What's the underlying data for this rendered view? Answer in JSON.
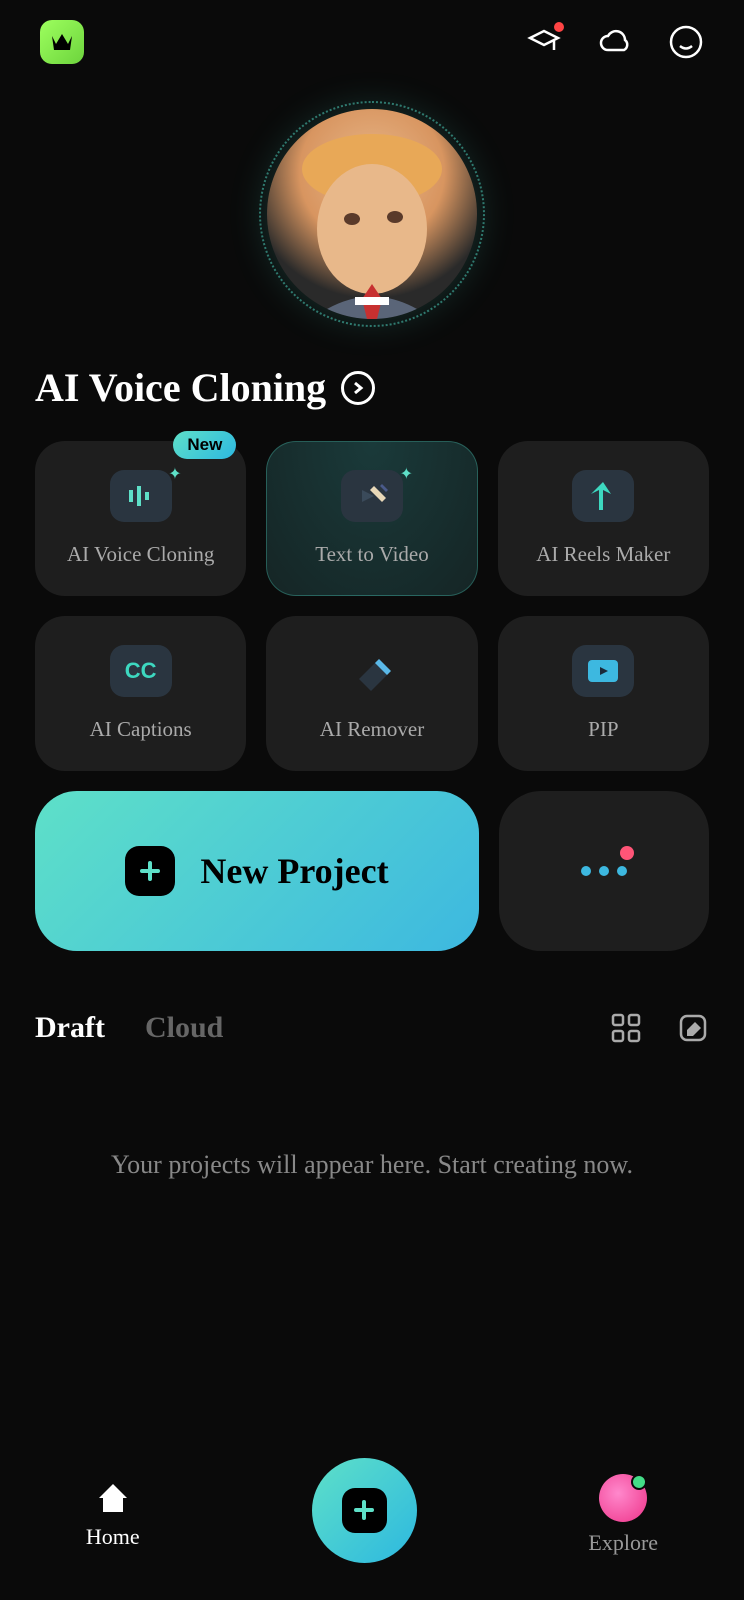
{
  "section_title": "AI Voice Cloning",
  "features": [
    {
      "label": "AI Voice Cloning",
      "badge": "New"
    },
    {
      "label": "Text to Video"
    },
    {
      "label": "AI Reels Maker"
    },
    {
      "label": "AI Captions"
    },
    {
      "label": "AI Remover"
    },
    {
      "label": "PIP"
    }
  ],
  "actions": {
    "new_project": "New Project"
  },
  "tabs": {
    "draft": "Draft",
    "cloud": "Cloud"
  },
  "empty_state": "Your projects will appear here. Start creating now.",
  "nav": {
    "home": "Home",
    "explore": "Explore"
  },
  "colors": {
    "accent_teal": "#5ee0c8",
    "accent_blue": "#3db8e0"
  }
}
